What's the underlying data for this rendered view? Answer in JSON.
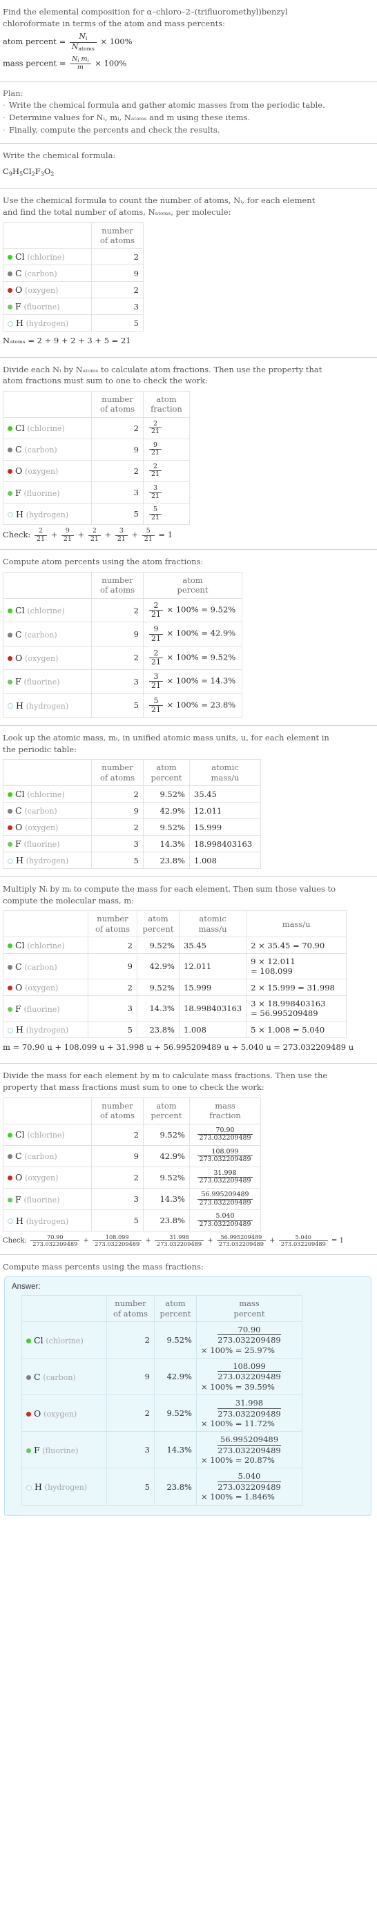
{
  "question": {
    "line1": "Find the elemental composition for α–chloro–2–(trifluoromethyl)benzyl",
    "line2": "chloroformate in terms of the atom and mass percents:",
    "atom_percent_label": "atom percent",
    "mass_percent_label": "mass percent",
    "percent_100": "× 100%"
  },
  "plan": {
    "title": "Plan:",
    "items": [
      "Write the chemical formula and gather atomic masses from the periodic table.",
      "Determine values for Nᵢ, mᵢ, Nₐₜₒₘₛ and m using these items.",
      "Finally, compute the percents and check the results."
    ]
  },
  "formula_step": {
    "prompt": "Write the chemical formula:",
    "formula": "C9H5Cl2F3O2"
  },
  "count_step": {
    "prompt_line1": "Use the chemical formula to count the number of atoms, Nᵢ, for each element",
    "prompt_line2": "and find the total number of atoms, Nₐₜₒₘₛ, per molecule:",
    "headers": [
      "",
      "number of atoms"
    ],
    "total_line": "Nₐₜₒₘₛ = 2 + 9 + 2 + 3 + 5 = 21"
  },
  "fraction_step": {
    "prompt_line1": "Divide each Nᵢ by Nₐₜₒₘₛ to calculate atom fractions. Then use the property that",
    "prompt_line2": "atom fractions must sum to one to check the work:",
    "headers": [
      "",
      "number of atoms",
      "atom fraction"
    ],
    "check_label": "Check:",
    "check_result": "= 1"
  },
  "atom_percent_step": {
    "prompt": "Compute atom percents using the atom fractions:",
    "headers": [
      "",
      "number of atoms",
      "atom percent"
    ]
  },
  "atomic_mass_step": {
    "prompt_line1": "Look up the atomic mass, mᵢ, in unified atomic mass units, u, for each element in",
    "prompt_line2": "the periodic table:",
    "headers": [
      "",
      "number of atoms",
      "atom percent",
      "atomic mass/u"
    ]
  },
  "mass_step": {
    "prompt_line1": "Multiply Nᵢ by mᵢ to compute the mass for each element. Then sum those values to",
    "prompt_line2": "compute the molecular mass, m:",
    "headers": [
      "",
      "number of atoms",
      "atom percent",
      "atomic mass/u",
      "mass/u"
    ],
    "total_line": "m = 70.90 u + 108.099 u + 31.998 u + 56.995209489 u + 5.040 u = 273.032209489 u"
  },
  "mass_fraction_step": {
    "prompt_line1": "Divide the mass for each element by m to calculate mass fractions. Then use the",
    "prompt_line2": "property that mass fractions must sum to one to check the work:",
    "headers": [
      "",
      "number of atoms",
      "atom percent",
      "mass fraction"
    ],
    "check_label": "Check:",
    "check_result": "= 1"
  },
  "mass_percent_step": {
    "prompt": "Compute mass percents using the mass fractions:",
    "answer_label": "Answer:",
    "headers": [
      "",
      "number of atoms",
      "atom percent",
      "mass percent"
    ]
  },
  "totals": {
    "n_atoms": "21",
    "molecular_mass": "273.032209489"
  },
  "colors": {
    "chlorine": "#3ed122",
    "carbon": "#808080",
    "oxygen": "#c62a22",
    "fluorine": "#6ec75e",
    "hydrogen": "#ffffff",
    "hydrogen_border": "#a9d9e0",
    "answer_bg": "#eaf7fb",
    "answer_border": "#bfe3ef"
  },
  "elements": [
    {
      "symbol": "Cl",
      "name": "(chlorine)",
      "dot": "chlorine",
      "count": "2",
      "fraction_num": "2",
      "fraction_den": "21",
      "atom_percent": "9.52%",
      "atomic_mass": "35.45",
      "mass_expr": "2 × 35.45 = 70.90",
      "mass_expr_a": "2 × 35.45 = 70.90",
      "mass_expr_b": "",
      "mass_value": "70.90",
      "mass_percent": "25.97%"
    },
    {
      "symbol": "C",
      "name": "(carbon)",
      "dot": "carbon",
      "count": "9",
      "fraction_num": "9",
      "fraction_den": "21",
      "atom_percent": "42.9%",
      "atomic_mass": "12.011",
      "mass_expr": "9 × 12.011 = 108.099",
      "mass_expr_a": "9 × 12.011",
      "mass_expr_b": "= 108.099",
      "mass_value": "108.099",
      "mass_percent": "39.59%"
    },
    {
      "symbol": "O",
      "name": "(oxygen)",
      "dot": "oxygen",
      "count": "2",
      "fraction_num": "2",
      "fraction_den": "21",
      "atom_percent": "9.52%",
      "atomic_mass": "15.999",
      "mass_expr": "2 × 15.999 = 31.998",
      "mass_expr_a": "2 × 15.999 = 31.998",
      "mass_expr_b": "",
      "mass_value": "31.998",
      "mass_percent": "11.72%"
    },
    {
      "symbol": "F",
      "name": "(fluorine)",
      "dot": "fluorine",
      "count": "3",
      "fraction_num": "3",
      "fraction_den": "21",
      "atom_percent": "14.3%",
      "atomic_mass": "18.998403163",
      "mass_expr": "3 × 18.998403163 = 56.995209489",
      "mass_expr_a": "3 × 18.998403163",
      "mass_expr_b": "= 56.995209489",
      "mass_value": "56.995209489",
      "mass_percent": "20.87%"
    },
    {
      "symbol": "H",
      "name": "(hydrogen)",
      "dot": "hydrogen",
      "count": "5",
      "fraction_num": "5",
      "fraction_den": "21",
      "atom_percent": "23.8%",
      "atomic_mass": "1.008",
      "mass_expr": "5 × 1.008 = 5.040",
      "mass_expr_a": "5 × 1.008 = 5.040",
      "mass_expr_b": "",
      "mass_value": "5.040",
      "mass_percent": "1.846%"
    }
  ],
  "chart_data": {
    "type": "table",
    "title": "Elemental composition of C9H5Cl2F3O2",
    "categories": [
      "Cl (chlorine)",
      "C (carbon)",
      "O (oxygen)",
      "F (fluorine)",
      "H (hydrogen)"
    ],
    "series": [
      {
        "name": "number of atoms",
        "values": [
          2,
          9,
          2,
          3,
          5
        ]
      },
      {
        "name": "atom percent",
        "values": [
          9.52,
          42.9,
          9.52,
          14.3,
          23.8
        ]
      },
      {
        "name": "atomic mass/u",
        "values": [
          35.45,
          12.011,
          15.999,
          18.998403163,
          1.008
        ]
      },
      {
        "name": "mass/u",
        "values": [
          70.9,
          108.099,
          31.998,
          56.995209489,
          5.04
        ]
      },
      {
        "name": "mass percent",
        "values": [
          25.97,
          39.59,
          11.72,
          20.87,
          1.846
        ]
      }
    ],
    "total_atoms": 21,
    "molecular_mass_u": 273.032209489
  }
}
